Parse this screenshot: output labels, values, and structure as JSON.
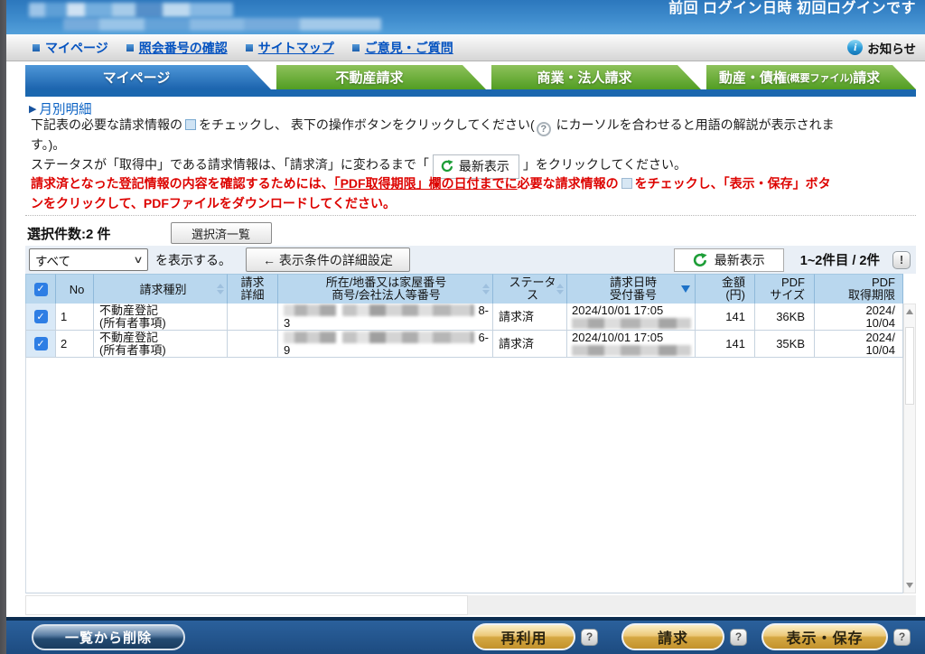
{
  "colors": {
    "header_blue": "#3f8ccd",
    "tab_active_blue": "#1c64ae",
    "tab_green": "#519d22",
    "underline_bar_blue": "#1b67af",
    "link_blue": "#0553c0",
    "warning_red": "#dd0300",
    "table_header_blue": "#b9d7ee",
    "checkbox_col_blue": "#d9e9f7",
    "footer_blue": "#1d4b80",
    "gold_button": "#d5a843",
    "refresh_green": "#1e9e38"
  },
  "icons": {
    "info": "i",
    "help": "?",
    "alert": "!",
    "checkmark": "✓",
    "breadcrumb_arrow": "▶",
    "dropdown_chevron": "∨"
  },
  "header": {
    "login_status": "前回 ログイン日時 初回ログインです"
  },
  "nav": {
    "items": [
      "マイページ",
      "照会番号の確認",
      "サイトマップ",
      "ご意見・ご質問"
    ],
    "notice_label": "お知らせ"
  },
  "tabs": {
    "mypage": "マイページ",
    "real_estate": "不動産請求",
    "corporate": "商業・法人請求",
    "movables_main": "動産・債権",
    "movables_small": "(概要ファイル)",
    "movables_tail": "請求"
  },
  "breadcrumb": {
    "label": "月別明細"
  },
  "instructions": {
    "l1_pre": "下記表の必要な請求情報の",
    "l1_mid": "をチェックし、 表下の操作ボタンをクリックしてください(",
    "l1_tail": " にカーソルを合わせると用語の解説が表示されま",
    "l2": "す。)。",
    "l3_pre": "ステータスが「取得中」である請求情報は、「請求済」に変わるまで「",
    "l3_chip": "最新表示",
    "l3_post": "」をクリックしてください。"
  },
  "warning": {
    "p1": "請求済となった登記情報の内容を確認するためには、",
    "underlined": "「PDF取得期限」欄の日付までに",
    "p2": "必要な請求情報の",
    "p3": "をチェックし、「表示・保存」ボタ",
    "l2": "ンをクリックして、PDFファイルをダウンロードしてください。"
  },
  "selection": {
    "count_label": "選択件数:2 件",
    "selected_list_button": "選択済一覧"
  },
  "filter": {
    "dropdown_value": "すべて",
    "suffix": "を表示する。",
    "settings_button": "← 表示条件の詳細設定",
    "refresh_button": "最新表示",
    "range": "1~2件目 / 2件"
  },
  "table": {
    "headers": {
      "no": "No",
      "type": "請求種別",
      "detail1": "請求",
      "detail2": "詳細",
      "address1": "所在/地番又は家屋番号",
      "address2": "商号/会社法人等番号",
      "status1": "ステータ",
      "status2": "ス",
      "datetime1": "請求日時",
      "datetime2": "受付番号",
      "amount1": "金額",
      "amount2": "(円)",
      "size1": "PDF",
      "size2": "サイズ",
      "deadline1": "PDF",
      "deadline2": "取得期限"
    },
    "rows": [
      {
        "no": "1",
        "type1": "不動産登記",
        "type2": "(所有者事項)",
        "addr_suffix": "8-",
        "addr_line2": "3",
        "status": "請求済",
        "datetime": "2024/10/01 17:05",
        "amount": "141",
        "size": "36KB",
        "deadline1": "2024/",
        "deadline2": "10/04"
      },
      {
        "no": "2",
        "type1": "不動産登記",
        "type2": "(所有者事項)",
        "addr_suffix": "6-",
        "addr_line2": "9",
        "status": "請求済",
        "datetime": "2024/10/01 17:05",
        "amount": "141",
        "size": "35KB",
        "deadline1": "2024/",
        "deadline2": "10/04"
      }
    ]
  },
  "footer": {
    "delete_button": "一覧から削除",
    "reuse_button": "再利用",
    "request_button": "請求",
    "save_button": "表示・保存"
  }
}
